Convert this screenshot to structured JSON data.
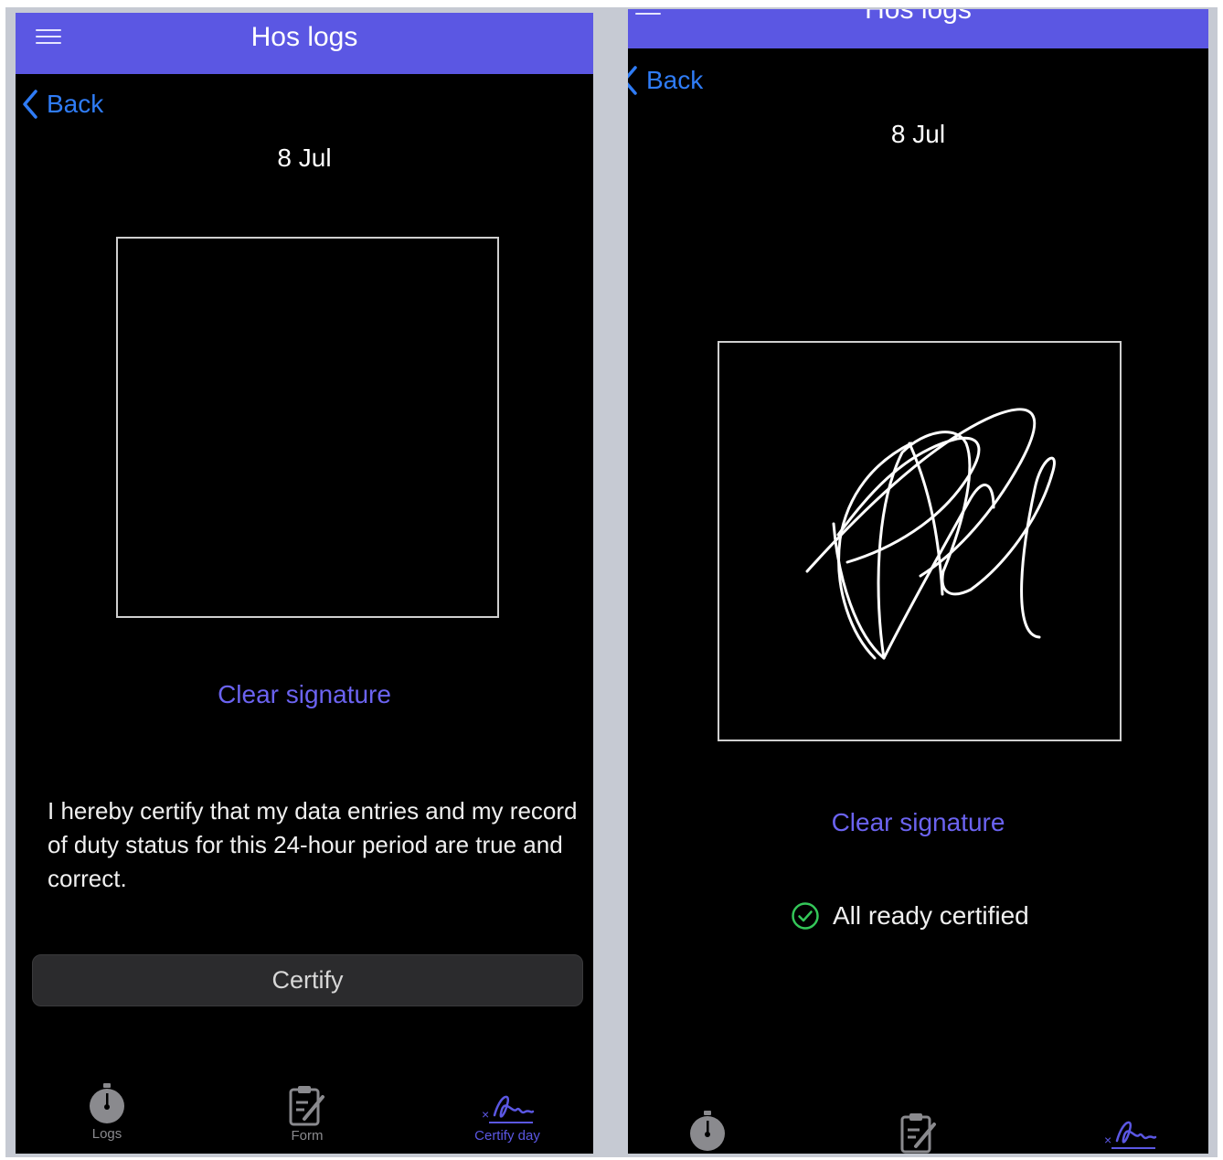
{
  "left_screen": {
    "app_title": "Hos logs",
    "back_label": "Back",
    "date": "8 Jul",
    "clear_signature_label": "Clear signature",
    "certification_text": "I hereby certify that my data entries and my record of duty status for this 24-hour period are true and correct.",
    "certify_button_label": "Certify",
    "tabs": [
      {
        "label": "Logs",
        "icon": "stopwatch-icon",
        "active": false
      },
      {
        "label": "Form",
        "icon": "form-edit-icon",
        "active": false
      },
      {
        "label": "Certify day",
        "icon": "signature-icon",
        "active": true
      }
    ]
  },
  "right_screen": {
    "app_title": "Hos logs",
    "back_label": "Back",
    "date": "8 Jul",
    "clear_signature_label": "Clear signature",
    "status_text": "All ready certified",
    "status_icon": "check-circle-icon",
    "signature_present": true
  },
  "colors": {
    "header": "#5b57e3",
    "link_blue": "#2f7cf6",
    "accent_purple": "#6b63f0",
    "success_green": "#34c759",
    "background": "#000000"
  }
}
